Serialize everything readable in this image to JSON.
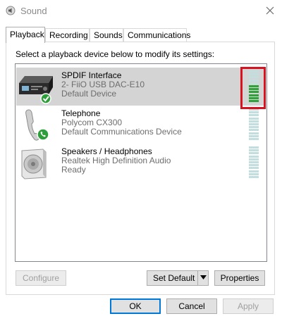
{
  "window": {
    "title": "Sound",
    "icon": "speaker-icon"
  },
  "tabs": [
    {
      "label": "Playback",
      "active": true
    },
    {
      "label": "Recording",
      "active": false
    },
    {
      "label": "Sounds",
      "active": false
    },
    {
      "label": "Communications",
      "active": false
    }
  ],
  "instructions": "Select a playback device below to modify its settings:",
  "devices": [
    {
      "name": "SPDIF Interface",
      "line2": "2- FiiO USB DAC-E10",
      "line3": "Default Device",
      "icon": "spdif-receiver-icon",
      "badge": "green-check",
      "selected": true,
      "level_segments_on": 6,
      "level_segments_total": 11
    },
    {
      "name": "Telephone",
      "line2": "Polycom CX300",
      "line3": "Default Communications Device",
      "icon": "telephone-handset-icon",
      "badge": "green-phone",
      "selected": false,
      "level_segments_on": 0,
      "level_segments_total": 11
    },
    {
      "name": "Speakers / Headphones",
      "line2": "Realtek High Definition Audio",
      "line3": "Ready",
      "icon": "speaker-box-icon",
      "badge": "none",
      "selected": false,
      "level_segments_on": 0,
      "level_segments_total": 11
    }
  ],
  "buttons": {
    "configure": "Configure",
    "set_default": "Set Default",
    "properties": "Properties",
    "ok": "OK",
    "cancel": "Cancel",
    "apply": "Apply"
  },
  "colors": {
    "meter_on": "#2ea33a",
    "meter_off": "#c2dede",
    "highlight": "#d8121e",
    "selected_row": "#d4d4d4"
  }
}
